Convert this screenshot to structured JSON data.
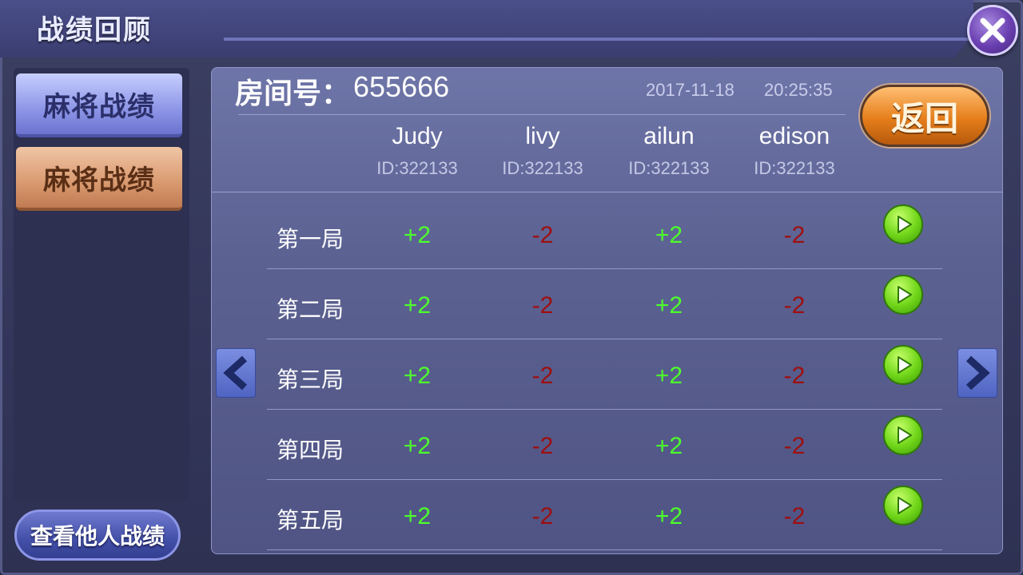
{
  "window": {
    "title": "战绩回顾"
  },
  "sidebar": {
    "tabs": [
      {
        "label": "麻将战绩",
        "active": true
      },
      {
        "label": "麻将战绩",
        "active": false
      }
    ],
    "others_button": "查看他人战绩"
  },
  "room": {
    "label": "房间号：",
    "number": "655666",
    "date": "2017-11-18",
    "time": "20:25:35"
  },
  "return_button": "返回",
  "players": [
    {
      "name": "Judy",
      "id": "ID:322133"
    },
    {
      "name": "livy",
      "id": "ID:322133"
    },
    {
      "name": "ailun",
      "id": "ID:322133"
    },
    {
      "name": "edison",
      "id": "ID:322133"
    }
  ],
  "rounds": [
    {
      "label": "第一局",
      "scores": [
        "+2",
        "-2",
        "+2",
        "-2"
      ]
    },
    {
      "label": "第二局",
      "scores": [
        "+2",
        "-2",
        "+2",
        "-2"
      ]
    },
    {
      "label": "第三局",
      "scores": [
        "+2",
        "-2",
        "+2",
        "-2"
      ]
    },
    {
      "label": "第四局",
      "scores": [
        "+2",
        "-2",
        "+2",
        "-2"
      ]
    },
    {
      "label": "第五局",
      "scores": [
        "+2",
        "-2",
        "+2",
        "-2"
      ]
    }
  ],
  "colors": {
    "positive": "#4dff2b",
    "negative": "#9e0f0f",
    "accent": "#e57e1b"
  },
  "icons": {
    "close": "close-icon",
    "play": "play-icon",
    "prev": "chevron-left-icon",
    "next": "chevron-right-icon"
  }
}
